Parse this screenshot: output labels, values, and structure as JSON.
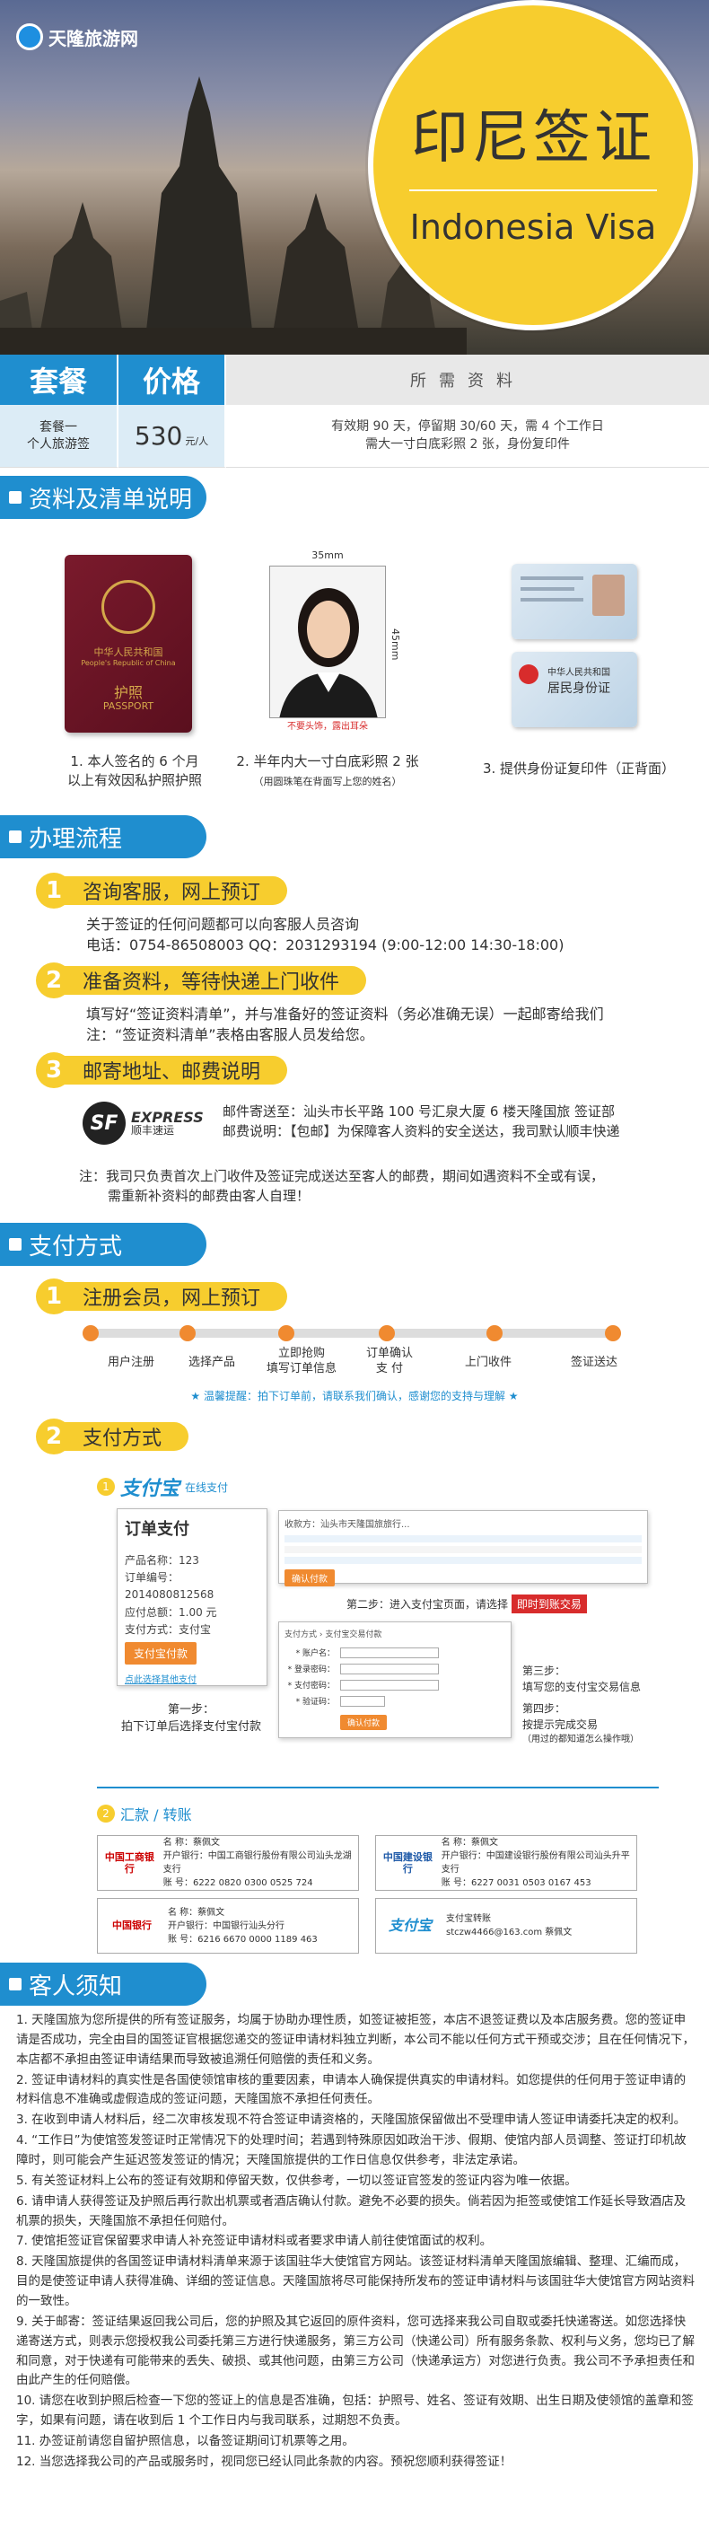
{
  "brand": {
    "name": "天隆旅游网"
  },
  "hero": {
    "title_cn": "印尼签证",
    "title_en": "Indonesia Visa"
  },
  "price_table": {
    "headers": [
      "套餐",
      "价格",
      "所需资料"
    ],
    "row": {
      "package_line1": "套餐一",
      "package_line2": "个人旅游签",
      "price": "530",
      "price_unit": "元/人",
      "req_line1": "有效期 90 天，停留期 30/60 天，需 4 个工作日",
      "req_line2": "需大一寸白底彩照 2 张，身份复印件"
    }
  },
  "sections": {
    "materials": "资料及清单说明",
    "process": "办理流程",
    "payment": "支付方式",
    "notice": "客人须知"
  },
  "materials": {
    "passport_label1": "中华人民共和国",
    "passport_label2": "People's Republic of China",
    "passport_label3": "护照",
    "passport_label4": "PASSPORT",
    "photo_w": "35mm",
    "photo_h": "45mm",
    "photo_note": "不要头饰，露出耳朵",
    "id_title": "中华人民共和国",
    "id_sub": "居民身份证",
    "cap1_line1": "1. 本人签名的 6 个月",
    "cap1_line2": "以上有效因私护照护照",
    "cap2_line1": "2. 半年内大一寸白底彩照 2 张",
    "cap2_line2": "（用圆珠笔在背面写上您的姓名）",
    "cap3": "3. 提供身份证复印件（正背面）"
  },
  "process": {
    "step1_title": "咨询客服，网上预订",
    "step1_line1": "关于签证的任何问题都可以向客服人员咨询",
    "step1_line2": "电话：0754-86508003    QQ：2031293194  (9:00-12:00  14:30-18:00)",
    "step2_title": "准备资料，等待快递上门收件",
    "step2_line1": "填写好“签证资料清单”，并与准备好的签证资料（务必准确无误）一起邮寄给我们",
    "step2_line2": "注：“签证资料清单”表格由客服人员发给您。",
    "step3_title": "邮寄地址、邮费说明",
    "sf_brand": "SF",
    "sf_express": "EXPRESS",
    "sf_cn": "顺丰速运",
    "step3_line1": "邮件寄送至：汕头市长平路 100 号汇泉大厦 6 楼天隆国旅  签证部",
    "step3_line2": "邮费说明：【包邮】为保障客人资料的安全送达，我司默认顺丰快递",
    "step3_note1": "注：我司只负责首次上门收件及签证完成送达至客人的邮费，期间如遇资料不全或有误，",
    "step3_note2": "需重新补资料的邮费由客人自理！"
  },
  "payment": {
    "step1_title": "注册会员，网上预订",
    "progress_labels": [
      "用户注册",
      "选择产品",
      "立即抢购\n填写订单信息",
      "订单确认\n支 付",
      "上门收件",
      "签证送达"
    ],
    "tip": "★ 温馨提醒：拍下订单前，请联系我们确认，感谢您的支持与理解 ★",
    "step2_title": "支付方式",
    "online_num": "1",
    "alipay_logo": "支付宝",
    "alipay_online": "在线支付",
    "order_title": "订单支付",
    "order_lines": [
      "产品名称：123",
      "订单编号：2014080812568",
      "应付总额：1.00 元",
      "支付方式：支付宝"
    ],
    "order_pay_btn": "支付宝付款",
    "order_link": "点此选择其他支付",
    "step_a_line1": "第一步：",
    "step_a_line2": "拍下订单后选择支付宝付款",
    "cashier_top": "收款方：汕头市天隆国旅旅行...",
    "cashier_pay": "确认付款",
    "step_b": "第二步：进入支付宝页面，请选择",
    "step_b_btn": "即时到账交易",
    "form_head": "支付方式 › 支付宝交易付款",
    "form_labels": [
      "* 账户名：",
      "* 登录密码：",
      "* 支付密码：",
      "* 验证码："
    ],
    "form_btn": "确认付款",
    "step_c_1": "第三步：",
    "step_c_2": "填写您的支付宝交易信息",
    "step_c_3": "第四步：",
    "step_c_4": "按提示完成交易",
    "step_c_5": "（用过的都知道怎么操作哦）",
    "transfer_num": "2",
    "transfer_title": "汇款 / 转账",
    "banks": [
      {
        "logo": "中国工商银行",
        "name": "名   称：蔡佩文",
        "bank": "开户银行：中国工商银行股份有限公司汕头龙湖支行",
        "acct": "账   号：6222 0820 0300 0525 724"
      },
      {
        "logo": "中国建设银行",
        "name": "名   称：蔡佩文",
        "bank": "开户银行：中国建设银行股份有限公司汕头升平支行",
        "acct": "账   号：6227 0031 0503 0167 453"
      },
      {
        "logo": "中国银行",
        "name": "名   称：蔡佩文",
        "bank": "开户银行：中国银行汕头分行",
        "acct": "账   号：6216 6670 0000 1189 463"
      },
      {
        "logo": "支付宝",
        "name": "支付宝转账",
        "bank": "stczw4466@163.com     蔡佩文",
        "acct": ""
      }
    ]
  },
  "notice": [
    "1. 天隆国旅为您所提供的所有签证服务，均属于协助办理性质，如签证被拒签，本店不退签证费以及本店服务费。您的签证申请是否成功，完全由目的国签证官根据您递交的签证申请材料独立判断，本公司不能以任何方式干预或交涉；且在任何情况下，本店都不承担由签证申请结果而导致被追溯任何赔偿的责任和义务。",
    "2. 签证申请材料的真实性是各国使领馆审核的重要因素，申请本人确保提供真实的申请材料。如您提供的任何用于签证申请的材料信息不准确或虚假造成的签证问题，天隆国旅不承担任何责任。",
    "3. 在收到申请人材料后，经二次审核发现不符合签证申请资格的，天隆国旅保留做出不受理申请人签证申请委托决定的权利。",
    "4. “工作日”为使馆签发签证时正常情况下的处理时间；若遇到特殊原因如政治干涉、假期、使馆内部人员调整、签证打印机故障时，则可能会产生延迟签发签证的情况；天隆国旅提供的工作日信息仅供参考，非法定承诺。",
    "5. 有关签证材料上公布的签证有效期和停留天数，仅供参考，一切以签证官签发的签证内容为唯一依据。",
    "6. 请申请人获得签证及护照后再行款出机票或者酒店确认付款。避免不必要的损失。倘若因为拒签或使馆工作延长导致酒店及机票的损失，天隆国旅不承担任何赔付。",
    "7. 使馆拒签证官保留要求申请人补充签证申请材料或者要求申请人前往使馆面试的权利。",
    "8. 天隆国旅提供的各国签证申请材料清单来源于该国驻华大使馆官方网站。该签证材料清单天隆国旅编辑、整理、汇编而成，目的是使签证申请人获得准确、详细的签证信息。天隆国旅将尽可能保持所发布的签证申请材料与该国驻华大使馆官方网站资料的一致性。",
    "9. 关于邮寄：签证结果返回我公司后，您的护照及其它返回的原件资料，您可选择来我公司自取或委托快递寄送。如您选择快递寄送方式，则表示您授权我公司委托第三方进行快递服务，第三方公司（快递公司）所有服务条款、权利与义务，您均已了解和同意，对于快递有可能带来的丢失、破损、或其他问题，由第三方公司（快递承运方）对您进行负责。我公司不予承担责任和由此产生的任何赔偿。",
    "10. 请您在收到护照后检查一下您的签证上的信息是否准确，包括：护照号、姓名、签证有效期、出生日期及使领馆的盖章和签字，如果有问题，请在收到后 1 个工作日内与我司联系，过期恕不负责。",
    "11. 办签证前请您自留护照信息，以备签证期间订机票等之用。",
    "12. 当您选择我公司的产品或服务时，视同您已经认同此条款的内容。预祝您顺利获得签证！"
  ],
  "colors": {
    "primary": "#1f8ecf",
    "accent": "#f7cd2e",
    "orange": "#f08a30",
    "red": "#d82c2c"
  }
}
